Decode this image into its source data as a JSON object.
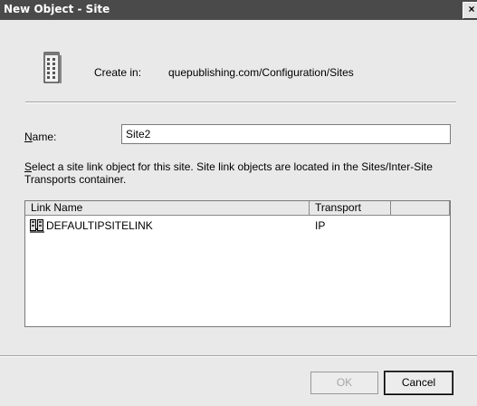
{
  "window": {
    "title": "New Object - Site",
    "close_symbol": "×"
  },
  "create_in": {
    "icon": "site-object-icon",
    "label": "Create in:",
    "path": "quepublishing.com/Configuration/Sites"
  },
  "name_field": {
    "label_access_key": "N",
    "label_rest": "ame:",
    "value": "Site2"
  },
  "instructions": {
    "access_key": "S",
    "text_rest": "elect a site link object for this site. Site link objects are located in the Sites/Inter-Site Transports container."
  },
  "site_links": {
    "columns": [
      "Link Name",
      "Transport",
      ""
    ],
    "rows": [
      {
        "icon": "site-link-icon",
        "name": "DEFAULTIPSITELINK",
        "transport": "IP"
      }
    ]
  },
  "buttons": {
    "ok": "OK",
    "cancel": "Cancel"
  }
}
